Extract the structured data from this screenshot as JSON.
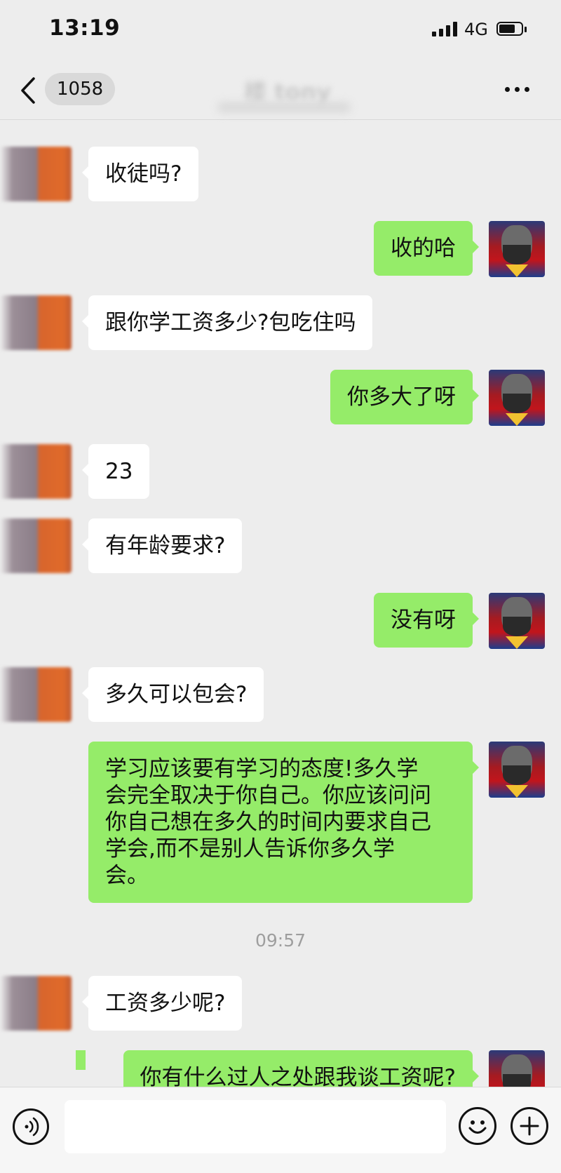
{
  "status_bar": {
    "time": "13:19",
    "network": "4G",
    "signal_icon": "cellular-signal-icon",
    "battery_icon": "battery-icon"
  },
  "nav": {
    "back_icon": "chevron-left-icon",
    "unread_count": "1058",
    "title": "楼 tony",
    "more_icon": "more-horizontal-icon"
  },
  "colors": {
    "incoming_bubble": "#ffffff",
    "outgoing_bubble": "#95ec69",
    "background": "#ededed"
  },
  "messages": [
    {
      "direction": "in",
      "text": "收徒吗?"
    },
    {
      "direction": "out",
      "text": "收的哈"
    },
    {
      "direction": "in",
      "text": "跟你学工资多少?包吃住吗"
    },
    {
      "direction": "out",
      "text": "你多大了呀"
    },
    {
      "direction": "in",
      "text": "23"
    },
    {
      "direction": "in",
      "text": "有年龄要求?"
    },
    {
      "direction": "out",
      "text": "没有呀"
    },
    {
      "direction": "in",
      "text": "多久可以包会?"
    },
    {
      "direction": "out",
      "text": "学习应该要有学习的态度!多久学\n会完全取决于你自己。你应该问问\n你自己想在多久的时间内要求自己\n学会,而不是别人告诉你多久学\n会。"
    },
    {
      "direction": "in",
      "text": "工资多少呢?"
    },
    {
      "direction": "out",
      "text": "你有什么过人之处跟我谈工资呢?"
    }
  ],
  "timestamp": "09:57",
  "input_bar": {
    "voice_icon": "voice-input-icon",
    "placeholder": "",
    "emoji_icon": "emoji-icon",
    "plus_icon": "plus-icon"
  }
}
